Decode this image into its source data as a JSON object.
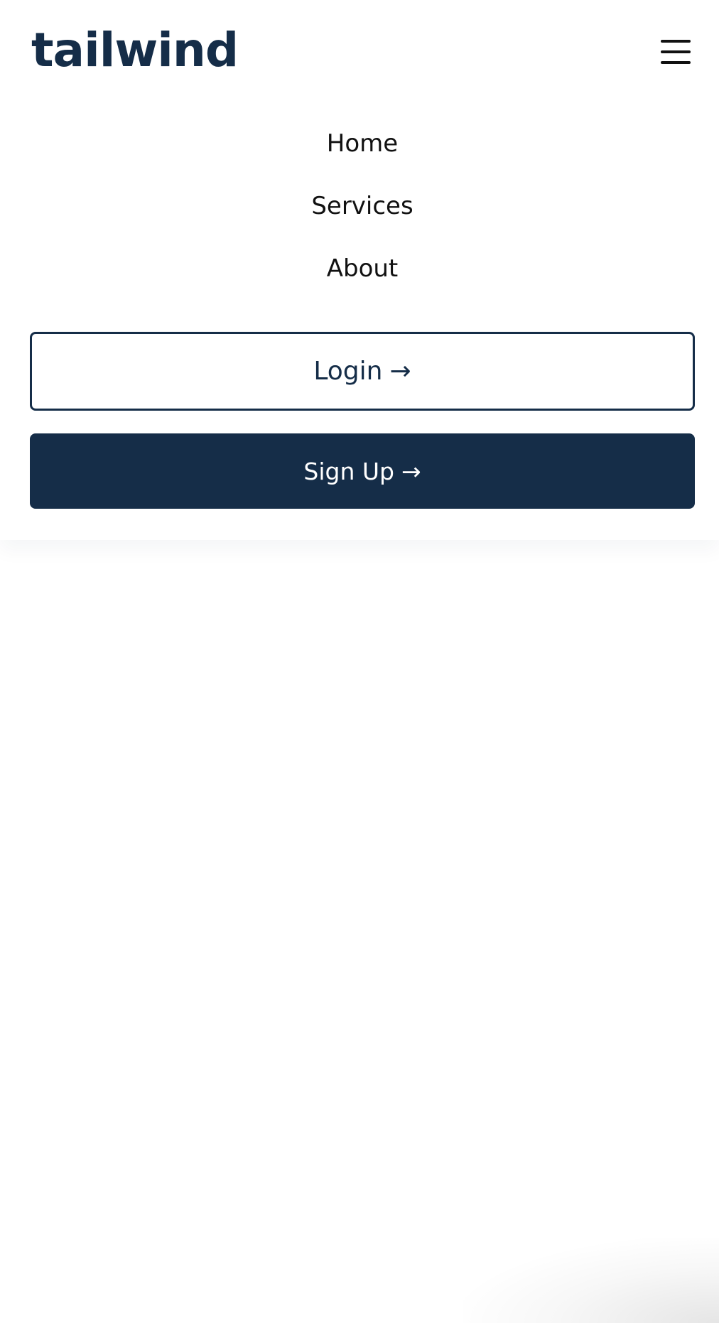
{
  "header": {
    "logo_text": "tailwind",
    "menu_icon": "hamburger-menu-icon"
  },
  "nav": {
    "items": [
      {
        "label": "Home"
      },
      {
        "label": "Services"
      },
      {
        "label": "About"
      }
    ]
  },
  "actions": {
    "login_label": "Login",
    "signup_label": "Sign Up",
    "arrow_glyph": "→",
    "arrow_icon": "arrow-right-icon"
  },
  "colors": {
    "brand_navy": "#152d48",
    "background": "#ffffff",
    "nav_text": "#111111"
  }
}
